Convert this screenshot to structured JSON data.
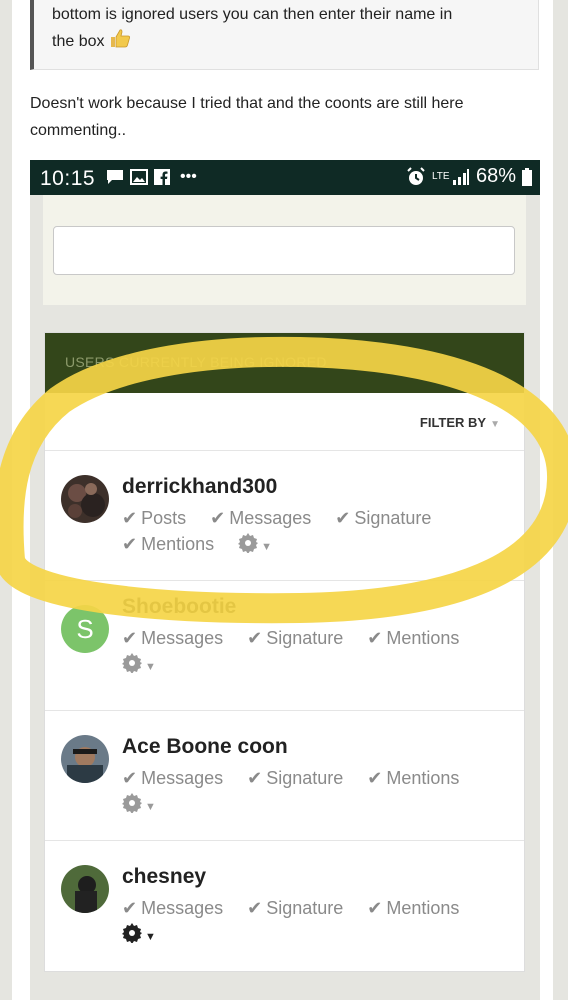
{
  "quote": {
    "line1": "bottom is ignored users you can then enter their name in",
    "line2": "the box"
  },
  "post": {
    "line1": "Doesn't work because I tried that and the coonts are still here",
    "line2": "commenting.."
  },
  "status_bar": {
    "time": "10:15",
    "battery": "68%",
    "network": "LTE"
  },
  "ignored_panel": {
    "title": "USERS CURRENTLY BEING IGNORED",
    "filter_label": "FILTER BY",
    "users": [
      {
        "name": "derrickhand300",
        "options": [
          "Posts",
          "Messages",
          "Signature",
          "Mentions"
        ]
      },
      {
        "name": "Shoebootie",
        "avatar_letter": "S",
        "options": [
          "Messages",
          "Signature",
          "Mentions"
        ]
      },
      {
        "name": "Ace Boone coon",
        "options": [
          "Messages",
          "Signature",
          "Mentions"
        ]
      },
      {
        "name": "chesney",
        "options": [
          "Messages",
          "Signature",
          "Mentions"
        ]
      }
    ]
  },
  "colors": {
    "header_green": "#33461a",
    "status_bar": "#0f2a25",
    "highlight_yellow": "#f5d547",
    "avatar_green": "#7cc46a"
  }
}
